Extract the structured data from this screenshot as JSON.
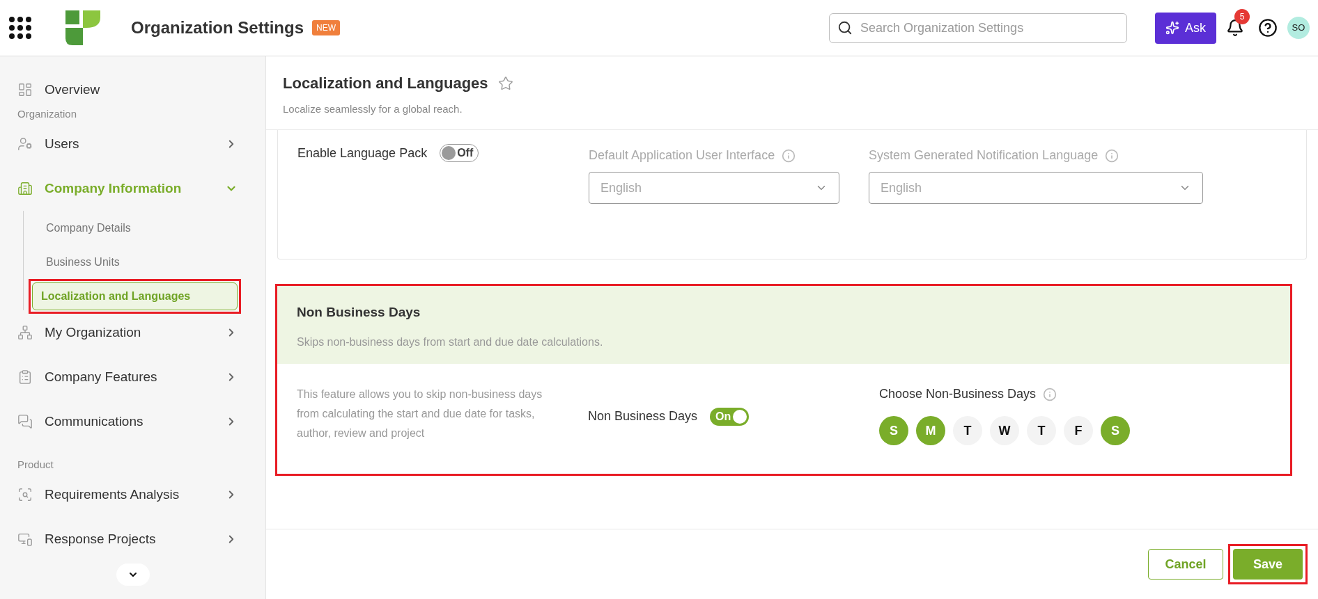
{
  "header": {
    "title": "Organization Settings",
    "badge": "NEW",
    "search": {
      "placeholder": "Search Organization Settings"
    },
    "ask_button": "Ask",
    "notifications": "5",
    "avatar": "SO"
  },
  "sidebar": [
    {
      "kind": "link",
      "label": "Overview"
    },
    {
      "kind": "heading",
      "label": "Organization"
    },
    {
      "kind": "group",
      "label": "Users",
      "expanded": false,
      "active": false
    },
    {
      "kind": "group",
      "label": "Company Information",
      "expanded": true,
      "active": true,
      "children": [
        {
          "label": "Company Details",
          "selected": false,
          "highlighted": false
        },
        {
          "label": "Business Units",
          "selected": false,
          "highlighted": false
        },
        {
          "label": "Localization and Languages",
          "selected": true,
          "highlighted": true
        }
      ]
    },
    {
      "kind": "group",
      "label": "My Organization",
      "expanded": false,
      "active": false
    },
    {
      "kind": "group",
      "label": "Company Features",
      "expanded": false,
      "active": false
    },
    {
      "kind": "group",
      "label": "Communications",
      "expanded": false,
      "active": false
    },
    {
      "kind": "heading",
      "label": "Product"
    },
    {
      "kind": "group",
      "label": "Requirements Analysis",
      "expanded": false,
      "active": false
    },
    {
      "kind": "group",
      "label": "Response Projects",
      "expanded": false,
      "active": false
    }
  ],
  "page": {
    "title": "Localization and Languages",
    "favorite": false,
    "subtitle": "Localize seamlessly for a global reach."
  },
  "language_card": {
    "toggle": {
      "label": "Enable Language Pack",
      "on": false,
      "text": "Off"
    },
    "selects": [
      {
        "label": "Default Application User Interface",
        "value": "English"
      },
      {
        "label": "System Generated Notification Language",
        "value": "English"
      }
    ]
  },
  "non_business_card": {
    "highlighted": true,
    "title": "Non Business Days",
    "subtitle": "Skips non-business days from start and due date calculations.",
    "description": "This feature allows you to skip non-business days from calculating the start and due date for tasks, author, review and project",
    "toggle": {
      "label": "Non Business Days",
      "on": true,
      "text": "On"
    },
    "days_label": "Choose Non-Business Days",
    "days": [
      {
        "label": "S",
        "selected": true
      },
      {
        "label": "M",
        "selected": true
      },
      {
        "label": "T",
        "selected": false
      },
      {
        "label": "W",
        "selected": false
      },
      {
        "label": "T",
        "selected": false
      },
      {
        "label": "F",
        "selected": false
      },
      {
        "label": "S",
        "selected": true
      }
    ]
  },
  "footer": {
    "cancel": "Cancel",
    "save": {
      "label": "Save",
      "highlighted": true
    }
  }
}
